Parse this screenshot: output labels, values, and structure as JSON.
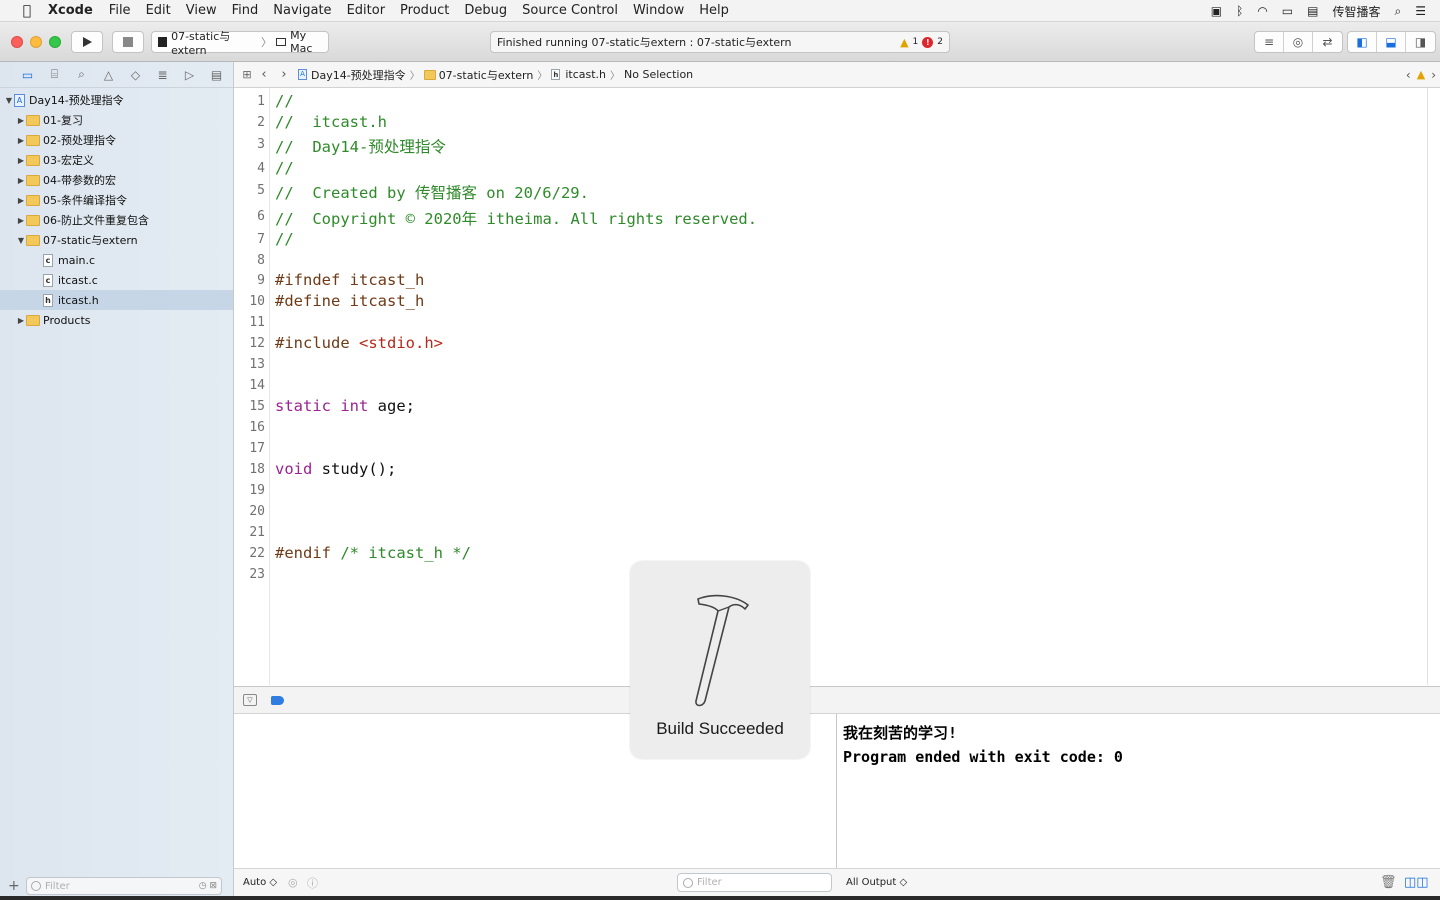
{
  "menubar": {
    "app": "Xcode",
    "items": [
      "File",
      "Edit",
      "View",
      "Find",
      "Navigate",
      "Editor",
      "Product",
      "Debug",
      "Source Control",
      "Window",
      "Help"
    ],
    "input_source": "传智播客"
  },
  "toolbar": {
    "scheme": "07-static与extern",
    "destination": "My Mac",
    "activity": "Finished running 07-static与extern : 07-static与extern",
    "warning_count": "1",
    "error_count": "2"
  },
  "navigator": {
    "project": "Day14-预处理指令",
    "items": [
      {
        "label": "01-复习",
        "type": "folder"
      },
      {
        "label": "02-预处理指令",
        "type": "folder"
      },
      {
        "label": "03-宏定义",
        "type": "folder"
      },
      {
        "label": "04-带参数的宏",
        "type": "folder"
      },
      {
        "label": "05-条件编译指令",
        "type": "folder"
      },
      {
        "label": "06-防止文件重复包含",
        "type": "folder"
      },
      {
        "label": "07-static与extern",
        "type": "folder-open"
      },
      {
        "label": "main.c",
        "type": "c-file"
      },
      {
        "label": "itcast.c",
        "type": "c-file"
      },
      {
        "label": "itcast.h",
        "type": "h-file"
      },
      {
        "label": "Products",
        "type": "folder"
      }
    ],
    "filter_placeholder": "Filter"
  },
  "jumpbar": {
    "crumbs": [
      "Day14-预处理指令",
      "07-static与extern",
      "itcast.h",
      "No Selection"
    ]
  },
  "editor": {
    "line_numbers": [
      "1",
      "2",
      "3",
      "4",
      "5",
      "6",
      "7",
      "8",
      "9",
      "10",
      "11",
      "12",
      "13",
      "14",
      "15",
      "16",
      "17",
      "18",
      "19",
      "20",
      "21",
      "22",
      "23"
    ],
    "lines": {
      "l1": "//",
      "l2": "//  itcast.h",
      "l3": "//  Day14-预处理指令",
      "l4": "//",
      "l5": "//  Created by 传智播客 on 20/6/29.",
      "l6": "//  Copyright © 2020年 itheima. All rights reserved.",
      "l7": "//",
      "l9": "#ifndef itcast_h",
      "l10": "#define itcast_h",
      "l12_pre": "#include ",
      "l12_str": "<stdio.h>",
      "l15_kw": "static int",
      "l15_rest": " age;",
      "l18_kw": "void",
      "l18_rest": " study();",
      "l22_pre": "#endif ",
      "l22_comment": "/* itcast_h */"
    }
  },
  "debug": {
    "scope_select": "Auto ◇",
    "output_select": "All Output ◇",
    "filter_placeholder": "Filter",
    "console_output": "我在刻苦的学习!\nProgram ended with exit code: 0"
  },
  "hud": {
    "label": "Build Succeeded"
  }
}
